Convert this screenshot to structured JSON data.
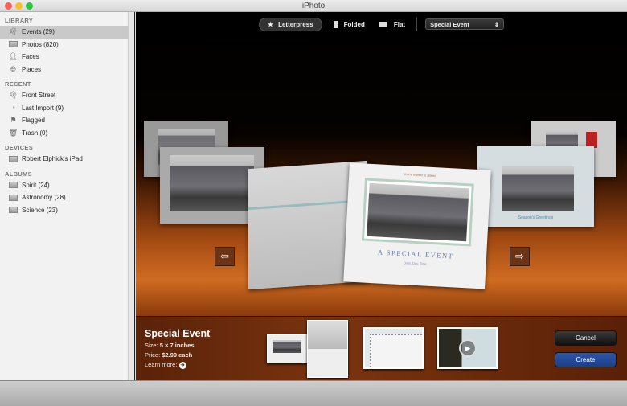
{
  "window": {
    "title": "iPhoto"
  },
  "sidebar": {
    "sections": [
      {
        "title": "LIBRARY",
        "items": [
          {
            "label": "Events (29)",
            "icon": "palm-tree-icon"
          },
          {
            "label": "Photos (820)",
            "icon": "photos-icon"
          },
          {
            "label": "Faces",
            "icon": "person-icon"
          },
          {
            "label": "Places",
            "icon": "globe-icon"
          }
        ]
      },
      {
        "title": "RECENT",
        "items": [
          {
            "label": "Front Street",
            "icon": "palm-tree-icon"
          },
          {
            "label": "Last Import (9)",
            "icon": "clock-icon"
          },
          {
            "label": "Flagged",
            "icon": "flag-icon"
          },
          {
            "label": "Trash (0)",
            "icon": "trash-icon"
          }
        ]
      },
      {
        "title": "DEVICES",
        "items": [
          {
            "label": "Robert Elphick's iPad",
            "icon": "ipad-icon"
          }
        ]
      },
      {
        "title": "ALBUMS",
        "items": [
          {
            "label": "Spirit (24)",
            "icon": "album-icon"
          },
          {
            "label": "Astronomy (28)",
            "icon": "album-icon"
          },
          {
            "label": "Science (23)",
            "icon": "album-icon"
          }
        ]
      }
    ]
  },
  "toolbar": {
    "letterpress": "Letterpress",
    "folded": "Folded",
    "flat": "Flat",
    "theme": "Special Event"
  },
  "card": {
    "invite": "You're invited to attend",
    "title": "A SPECIAL EVENT",
    "date": "Date, Day, Time",
    "greeting": "Season's Greetings"
  },
  "details": {
    "name": "Special Event",
    "size_label": "Size:",
    "size": "5 × 7 inches",
    "price_label": "Price:",
    "price": "$2.99 each",
    "learn_more": "Learn more:"
  },
  "buttons": {
    "cancel": "Cancel",
    "create": "Create"
  },
  "colors": {
    "create": "#1d3f8a",
    "selected": "#c9c9c9"
  }
}
